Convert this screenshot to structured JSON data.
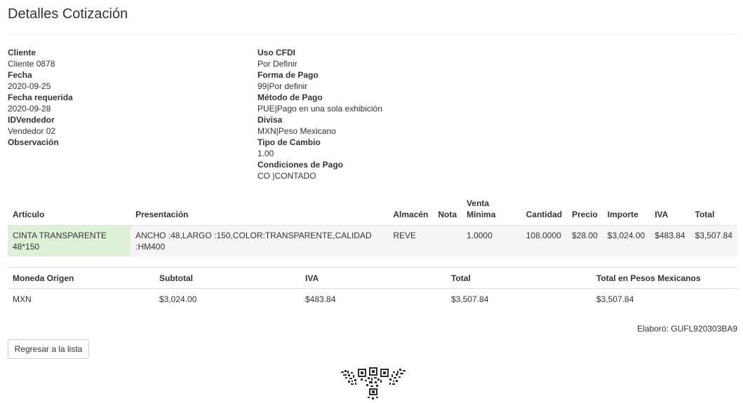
{
  "page": {
    "title": "Detalles Cotización"
  },
  "info_left": [
    {
      "label": "Cliente",
      "value": "Cliente 0878"
    },
    {
      "label": "Fecha",
      "value": "2020-09-25"
    },
    {
      "label": "Fecha requerida",
      "value": "2020-09-28"
    },
    {
      "label": "IDVendedor",
      "value": "Vendedor 02"
    },
    {
      "label": "Observación",
      "value": ""
    }
  ],
  "info_right": [
    {
      "label": "Uso CFDI",
      "value": "Por Definir"
    },
    {
      "label": "Forma de Pago",
      "value": "99|Por definir"
    },
    {
      "label": "Método de Pago",
      "value": "PUE|Pago en una sola exhibición"
    },
    {
      "label": "Divisa",
      "value": "MXN|Peso Mexicano"
    },
    {
      "label": "Tipo de Cambio",
      "value": "1.00"
    },
    {
      "label": "Condiciones de Pago",
      "value": "CO |CONTADO"
    }
  ],
  "items": {
    "headers": {
      "articulo": "Artículo",
      "presentacion": "Presentación",
      "almacen": "Almacén",
      "nota": "Nota",
      "venta_minima_1": "Venta",
      "venta_minima_2": "Mínima",
      "cantidad": "Cantidad",
      "precio": "Precio",
      "importe": "Importe",
      "iva": "IVA",
      "total": "Total"
    },
    "rows": [
      {
        "articulo_1": "CINTA TRANSPARENTE",
        "articulo_2": "48*150",
        "presentacion_1": "ANCHO :48,LARGO :150,COLOR:TRANSPARENTE,CALIDAD",
        "presentacion_2": ":HM400",
        "almacen": "REVE",
        "nota": "",
        "venta_minima": "1.0000",
        "cantidad": "108.0000",
        "precio": "$28.00",
        "importe": "$3,024.00",
        "iva": "$483.84",
        "total": "$3,507.84"
      }
    ]
  },
  "totals": {
    "headers": {
      "moneda_origen": "Moneda Origen",
      "subtotal": "Subtotal",
      "iva": "IVA",
      "total": "Total",
      "total_pesos": "Total en Pesos Mexicanos"
    },
    "row": {
      "moneda_origen": "MXN",
      "subtotal": "$3,024.00",
      "iva": "$483.84",
      "total": "$3,507.84",
      "total_pesos": "$3,507.84"
    }
  },
  "footer": {
    "elaboro": "Elaboró: GUFL920303BA9",
    "back_label": "Regresar a la lista",
    "seal_icon": "qr-seal-icon"
  }
}
